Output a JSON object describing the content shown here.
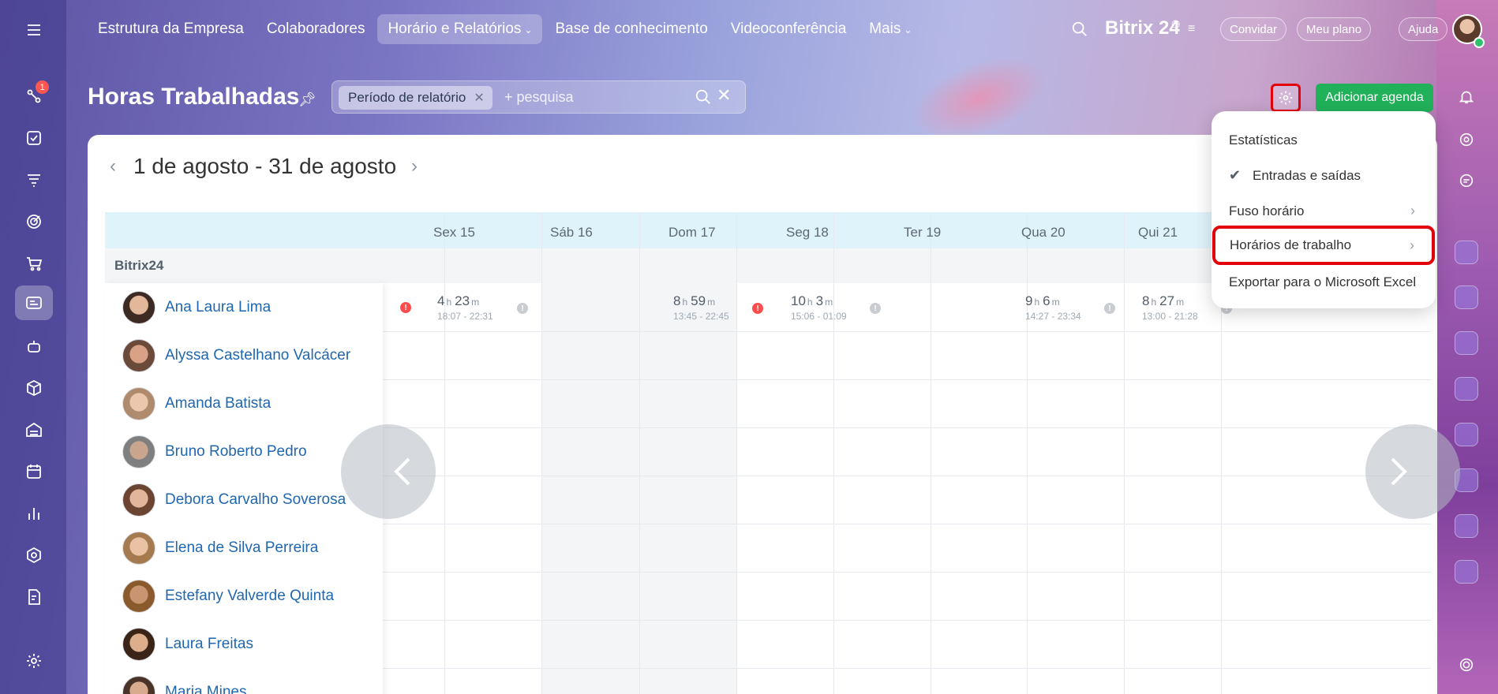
{
  "nav": {
    "items": [
      "Estrutura da Empresa",
      "Colaboradores",
      "Horário e Relatórios",
      "Base de conhecimento",
      "Videoconferência",
      "Mais"
    ],
    "brand": "Bitrix 24",
    "invite": "Convidar",
    "my_plan": "Meu plano",
    "help": "Ajuda"
  },
  "sidebar": {
    "badge": "1"
  },
  "page": {
    "title": "Horas Trabalhadas",
    "filter_chip": "Período de relatório",
    "search_placeholder": "+ pesquisa",
    "add_button": "Adicionar agenda",
    "period": "1 de agosto - 31 de agosto"
  },
  "grid": {
    "days": [
      "Sex 15",
      "Sáb 16",
      "Dom 17",
      "Seg 18",
      "Ter 19",
      "Qua 20",
      "Qui 21"
    ],
    "group": "Bitrix24",
    "employees": [
      "Ana Laura Lima",
      "Alyssa Castelhano Valcácer",
      "Amanda Batista",
      "Bruno Roberto Pedro",
      "Debora Carvalho Soverosa",
      "Elena de Silva Perreira",
      "Estefany Valverde Quinta",
      "Laura Freitas",
      "Maria Mines"
    ],
    "ana_cells": [
      {
        "h": "4",
        "m": "23",
        "range": "18:07 - 22:31"
      },
      {
        "h": "8",
        "m": "59",
        "range": "13:45 - 22:45"
      },
      {
        "h": "10",
        "m": "3",
        "range": "15:06 - 01:09"
      },
      {
        "h": "9",
        "m": "6",
        "range": "14:27 - 23:34"
      },
      {
        "h": "8",
        "m": "27",
        "range": "13:00 - 21:28"
      }
    ],
    "unit_h": "h",
    "unit_m": "m"
  },
  "menu": {
    "items": [
      "Estatísticas",
      "Entradas e saídas",
      "Fuso horário",
      "Horários de trabalho",
      "Exportar para o Microsoft Excel"
    ]
  }
}
